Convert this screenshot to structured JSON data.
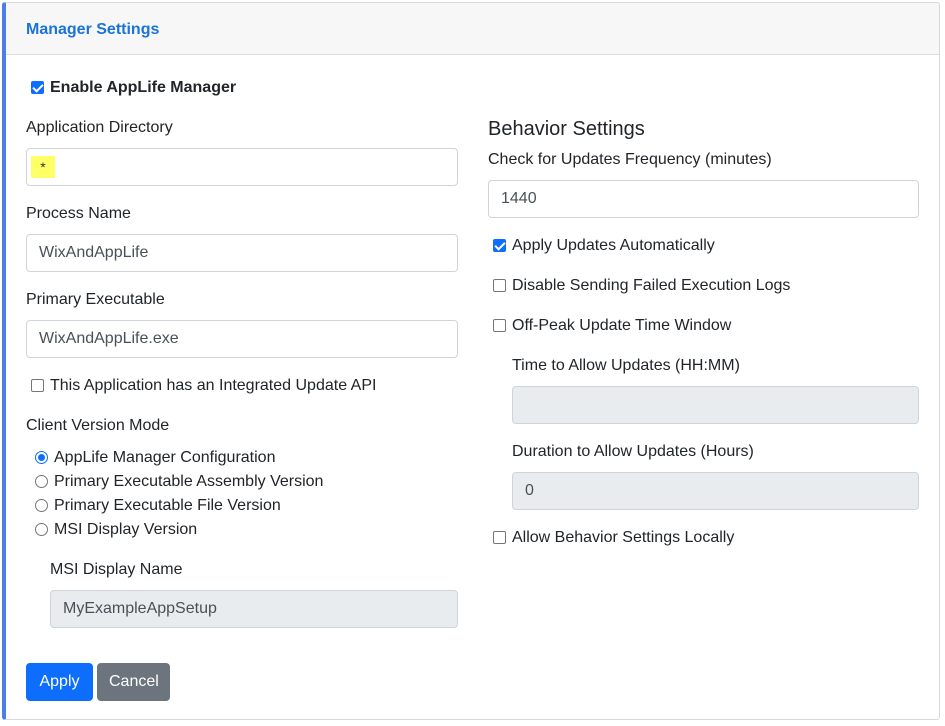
{
  "header": {
    "title": "Manager Settings"
  },
  "enable_manager": {
    "label": "Enable AppLife Manager",
    "checked": true
  },
  "left": {
    "app_dir": {
      "label": "Application Directory",
      "value": "*"
    },
    "process_name": {
      "label": "Process Name",
      "value": "WixAndAppLife"
    },
    "primary_exe": {
      "label": "Primary Executable",
      "value": "WixAndAppLife.exe"
    },
    "integrated_api": {
      "label": "This Application has an Integrated Update API",
      "checked": false
    },
    "version_mode": {
      "label": "Client Version Mode",
      "options": [
        {
          "label": "AppLife Manager Configuration",
          "checked": true
        },
        {
          "label": "Primary Executable Assembly Version",
          "checked": false
        },
        {
          "label": "Primary Executable File Version",
          "checked": false
        },
        {
          "label": "MSI Display Version",
          "checked": false
        }
      ]
    },
    "msi_name": {
      "label": "MSI Display Name",
      "value": "MyExampleAppSetup"
    }
  },
  "right": {
    "title": "Behavior Settings",
    "frequency": {
      "label": "Check for Updates Frequency (minutes)",
      "value": "1440"
    },
    "apply_auto": {
      "label": "Apply Updates Automatically",
      "checked": true
    },
    "disable_logs": {
      "label": "Disable Sending Failed Execution Logs",
      "checked": false
    },
    "off_peak": {
      "label": "Off-Peak Update Time Window",
      "checked": false
    },
    "time_allow": {
      "label": "Time to Allow Updates (HH:MM)",
      "value": ""
    },
    "duration_allow": {
      "label": "Duration to Allow Updates (Hours)",
      "value": "0"
    },
    "allow_local": {
      "label": "Allow Behavior Settings Locally",
      "checked": false
    }
  },
  "buttons": {
    "apply": "Apply",
    "cancel": "Cancel"
  },
  "colors": {
    "accent": "#0d6efd",
    "header_title": "#1a73d9",
    "left_border": "#4c7ee6",
    "secondary": "#6c757d"
  }
}
